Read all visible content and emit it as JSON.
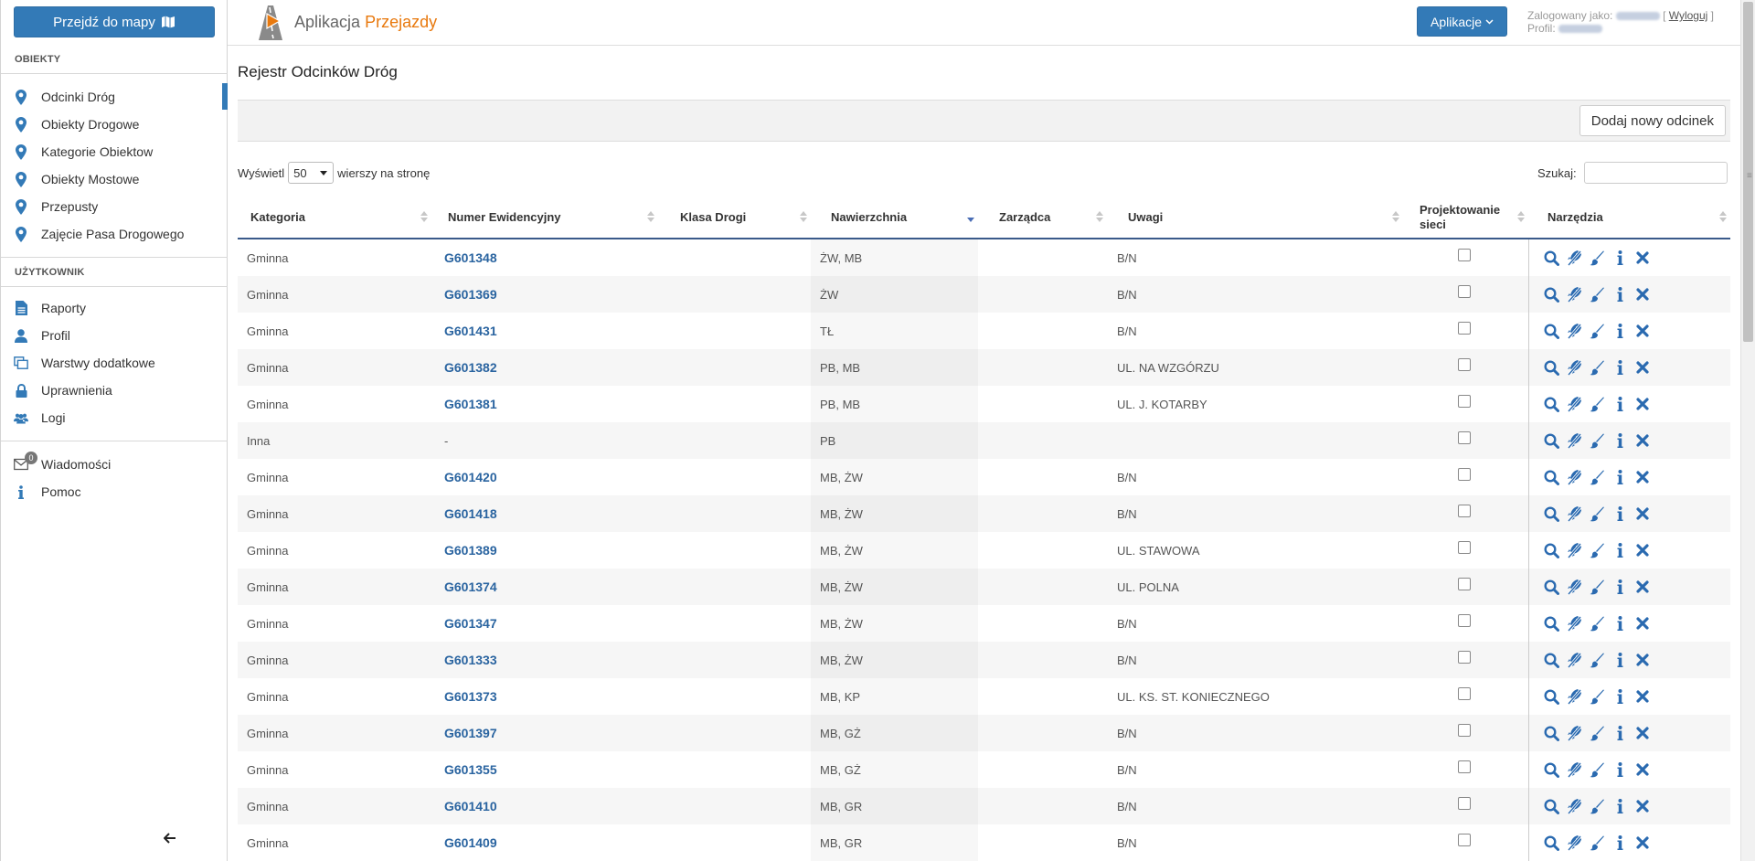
{
  "sidebar": {
    "map_button": "Przejdź do mapy",
    "section_objects": "OBIEKTY",
    "objects": [
      {
        "label": "Odcinki Dróg",
        "icon": "map-marker-icon"
      },
      {
        "label": "Obiekty Drogowe",
        "icon": "map-marker-icon"
      },
      {
        "label": "Kategorie Obiektow",
        "icon": "map-marker-icon"
      },
      {
        "label": "Obiekty Mostowe",
        "icon": "map-marker-icon"
      },
      {
        "label": "Przepusty",
        "icon": "map-marker-icon"
      },
      {
        "label": "Zajęcie Pasa Drogowego",
        "icon": "map-marker-icon"
      }
    ],
    "section_user": "UŻYTKOWNIK",
    "user_items": [
      {
        "label": "Raporty",
        "icon": "file-text-icon"
      },
      {
        "label": "Profil",
        "icon": "user-icon"
      },
      {
        "label": "Warstwy dodatkowe",
        "icon": "layers-icon"
      },
      {
        "label": "Uprawnienia",
        "icon": "lock-icon"
      },
      {
        "label": "Logi",
        "icon": "users-icon"
      }
    ],
    "misc_items": [
      {
        "label": "Wiadomości",
        "icon": "envelope-icon",
        "badge": "0"
      },
      {
        "label": "Pomoc",
        "icon": "info-icon"
      }
    ],
    "collapse_icon": "arrow-left-icon",
    "accent_color": "#337ab7"
  },
  "header": {
    "app_prefix": "Aplikacja",
    "app_accent": "Przejazdy",
    "apps_button": "Aplikacje",
    "logged_as_label": "Zalogowany jako:",
    "logout_label": "Wyloguj",
    "profile_label": "Profil:",
    "accent_color": "#e8790e"
  },
  "page": {
    "title": "Rejestr Odcinków Dróg",
    "add_button": "Dodaj nowy odcinek",
    "show_label": "Wyświetl",
    "page_length": "50",
    "rows_per_page_label": "wierszy na stronę",
    "search_label": "Szukaj:",
    "search_value": ""
  },
  "table": {
    "columns": [
      {
        "label": "Kategoria"
      },
      {
        "label": "Numer Ewidencyjny"
      },
      {
        "label": "Klasa Drogi"
      },
      {
        "label": "Nawierzchnia",
        "sorted": "desc"
      },
      {
        "label": "Zarządca"
      },
      {
        "label": "Uwagi"
      },
      {
        "label": "Projektowanie sieci"
      },
      {
        "label": "Narzędzia"
      }
    ],
    "rows": [
      {
        "kategoria": "Gminna",
        "numer": "G601348",
        "klasa": "",
        "nawierzchnia": "ŻW, MB",
        "zarzadca": "",
        "uwagi": "B/N"
      },
      {
        "kategoria": "Gminna",
        "numer": "G601369",
        "klasa": "",
        "nawierzchnia": "ŻW",
        "zarzadca": "",
        "uwagi": "B/N"
      },
      {
        "kategoria": "Gminna",
        "numer": "G601431",
        "klasa": "",
        "nawierzchnia": "TŁ",
        "zarzadca": "",
        "uwagi": "B/N"
      },
      {
        "kategoria": "Gminna",
        "numer": "G601382",
        "klasa": "",
        "nawierzchnia": "PB, MB",
        "zarzadca": "",
        "uwagi": "UL. NA WZGÓRZU"
      },
      {
        "kategoria": "Gminna",
        "numer": "G601381",
        "klasa": "",
        "nawierzchnia": "PB, MB",
        "zarzadca": "",
        "uwagi": "UL. J. KOTARBY"
      },
      {
        "kategoria": "Inna",
        "numer": "-",
        "klasa": "",
        "nawierzchnia": "PB",
        "zarzadca": "",
        "uwagi": ""
      },
      {
        "kategoria": "Gminna",
        "numer": "G601420",
        "klasa": "",
        "nawierzchnia": "MB, ŻW",
        "zarzadca": "",
        "uwagi": "B/N"
      },
      {
        "kategoria": "Gminna",
        "numer": "G601418",
        "klasa": "",
        "nawierzchnia": "MB, ŻW",
        "zarzadca": "",
        "uwagi": "B/N"
      },
      {
        "kategoria": "Gminna",
        "numer": "G601389",
        "klasa": "",
        "nawierzchnia": "MB, ŻW",
        "zarzadca": "",
        "uwagi": "UL. STAWOWA"
      },
      {
        "kategoria": "Gminna",
        "numer": "G601374",
        "klasa": "",
        "nawierzchnia": "MB, ŻW",
        "zarzadca": "",
        "uwagi": "UL. POLNA"
      },
      {
        "kategoria": "Gminna",
        "numer": "G601347",
        "klasa": "",
        "nawierzchnia": "MB, ŻW",
        "zarzadca": "",
        "uwagi": "B/N"
      },
      {
        "kategoria": "Gminna",
        "numer": "G601333",
        "klasa": "",
        "nawierzchnia": "MB, ŻW",
        "zarzadca": "",
        "uwagi": "B/N"
      },
      {
        "kategoria": "Gminna",
        "numer": "G601373",
        "klasa": "",
        "nawierzchnia": "MB, KP",
        "zarzadca": "",
        "uwagi": "UL. KS. ST. KONIECZNEGO"
      },
      {
        "kategoria": "Gminna",
        "numer": "G601397",
        "klasa": "",
        "nawierzchnia": "MB, GŻ",
        "zarzadca": "",
        "uwagi": "B/N"
      },
      {
        "kategoria": "Gminna",
        "numer": "G601355",
        "klasa": "",
        "nawierzchnia": "MB, GŻ",
        "zarzadca": "",
        "uwagi": "B/N"
      },
      {
        "kategoria": "Gminna",
        "numer": "G601410",
        "klasa": "",
        "nawierzchnia": "MB, GR",
        "zarzadca": "",
        "uwagi": "B/N"
      },
      {
        "kategoria": "Gminna",
        "numer": "G601409",
        "klasa": "",
        "nawierzchnia": "MB, GR",
        "zarzadca": "",
        "uwagi": "B/N"
      }
    ],
    "row_tools": [
      "search-icon",
      "rocket-off-icon",
      "brush-icon",
      "info-icon",
      "delete-icon"
    ],
    "link_color": "#2a64a0"
  }
}
